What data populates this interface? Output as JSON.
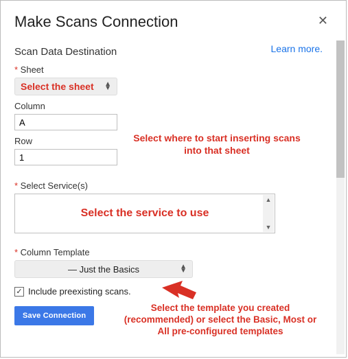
{
  "dialog": {
    "title": "Make Scans Connection",
    "close_glyph": "✕",
    "learn_more": "Learn more."
  },
  "destination": {
    "header": "Scan Data Destination",
    "sheet_label": "Sheet",
    "sheet_value": "Select the sheet",
    "column_label": "Column",
    "column_value": "A",
    "row_label": "Row",
    "row_value": "1"
  },
  "services": {
    "label": "Select Service(s)"
  },
  "template": {
    "label": "Column Template",
    "value": "— Just the Basics"
  },
  "include": {
    "checked": true,
    "label": "Include preexisting scans."
  },
  "buttons": {
    "save": "Save Connection"
  },
  "annotations": {
    "insert": "Select where to start inserting scans into that sheet",
    "service": "Select the service to use",
    "template": "Select the template you created (recommended) or select the Basic, Most or All pre-configured templates"
  }
}
